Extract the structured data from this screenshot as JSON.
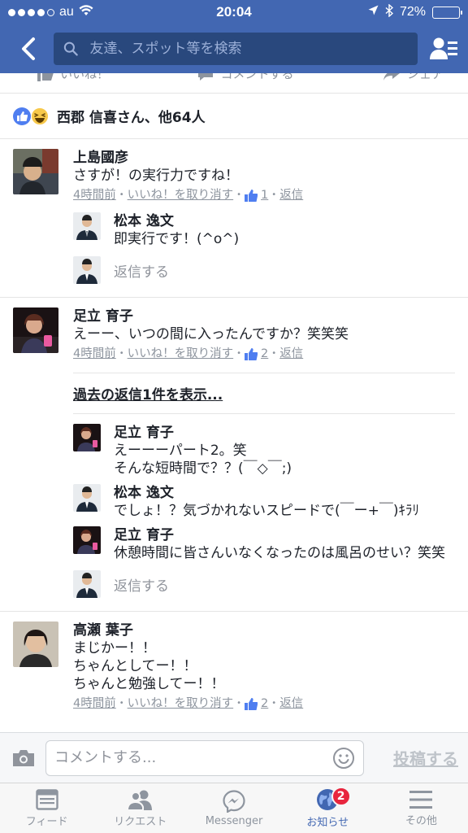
{
  "status_bar": {
    "carrier": "au",
    "time": "20:04",
    "battery": "72%",
    "battery_level": 0.72
  },
  "nav": {
    "search_placeholder": "友達、スポット等を検索"
  },
  "post_actions": {
    "like": "いいね！",
    "comment": "コメントする",
    "share": "シェア"
  },
  "reactions_summary": "西郡 信喜さん、他64人",
  "comments": [
    {
      "name": "上島國彦",
      "text": "さすが！の実行力ですね！",
      "time": "4時間前",
      "unlike": "いいね！を取り消す",
      "like_count": "1",
      "reply": "返信",
      "replies": [
        {
          "name": "松本 逸文",
          "text": "即実行です！(^o^)"
        }
      ],
      "reply_placeholder": "返信する"
    },
    {
      "name": "足立 育子",
      "text": "えーー、いつの間に入ったんですか？笑笑笑",
      "time": "4時間前",
      "unlike": "いいね！を取り消す",
      "like_count": "2",
      "reply": "返信",
      "show_more": "過去の返信1件を表示...",
      "replies": [
        {
          "name": "足立 育子",
          "text_lines": [
            "えーーーパート2。笑",
            "そんな短時間で？？(￣◇￣;)"
          ]
        },
        {
          "name": "松本 逸文",
          "text": "でしょ！？気づかれないスピードで(￣ー+￣)ｷﾗﾘ"
        },
        {
          "name": "足立 育子",
          "text": "休憩時間に皆さんいなくなったのは風呂のせい？笑笑"
        }
      ],
      "reply_placeholder": "返信する"
    },
    {
      "name": "高瀬 葉子",
      "text_lines": [
        "まじかー！！",
        "ちゃんとしてー！！",
        "ちゃんと勉強してー！！"
      ],
      "time": "4時間前",
      "unlike": "いいね！を取り消す",
      "like_count": "2",
      "reply": "返信"
    }
  ],
  "composer": {
    "placeholder": "コメントする...",
    "post_label": "投稿する"
  },
  "tabs": [
    {
      "label": "フィード",
      "icon": "feed-icon"
    },
    {
      "label": "リクエスト",
      "icon": "friend-requests-icon"
    },
    {
      "label": "Messenger",
      "icon": "messenger-icon"
    },
    {
      "label": "お知らせ",
      "icon": "globe-icon",
      "badge": "2",
      "active": true
    },
    {
      "label": "その他",
      "icon": "menu-icon"
    }
  ],
  "colors": {
    "brand": "#4267b2",
    "badge": "#e8253e"
  }
}
